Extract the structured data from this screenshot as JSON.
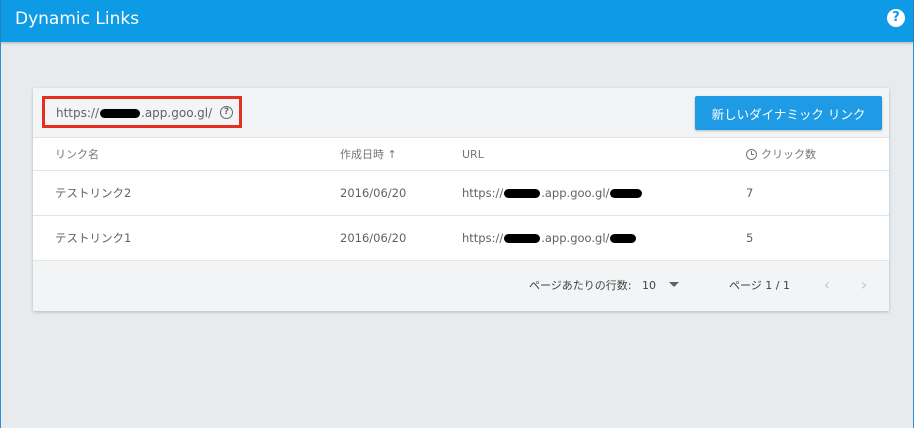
{
  "app": {
    "title": "Dynamic Links",
    "help_label": "?"
  },
  "card": {
    "domain": {
      "prefix": "https://",
      "suffix": ".app.goo.gl/",
      "help_label": "?"
    },
    "new_link_button": "新しいダイナミック リンク"
  },
  "table": {
    "headers": {
      "name": "リンク名",
      "created": "作成日時",
      "sort_arrow": "↑",
      "url": "URL",
      "clicks": "クリック数"
    },
    "rows": [
      {
        "name": "テストリンク2",
        "date": "2016/06/20",
        "url_prefix": "https://",
        "url_mid": ".app.goo.gl/",
        "clicks": "7"
      },
      {
        "name": "テストリンク1",
        "date": "2016/06/20",
        "url_prefix": "https://",
        "url_mid": ".app.goo.gl/",
        "clicks": "5"
      }
    ]
  },
  "footer": {
    "rows_per_page_label": "ページあたりの行数:",
    "rows_per_page_value": "10",
    "page_label": "ページ 1 / 1",
    "prev_icon": "‹",
    "next_icon": "›"
  },
  "icons": [
    "help-circle-icon",
    "question-icon",
    "sort-up-icon",
    "clock-icon",
    "dropdown-arrow-icon",
    "chevron-left-icon",
    "chevron-right-icon"
  ],
  "colors": {
    "topbar": "#0d9be6",
    "button": "#1e9be4",
    "highlight_border": "#e4311f",
    "background": "#e8ebee"
  }
}
